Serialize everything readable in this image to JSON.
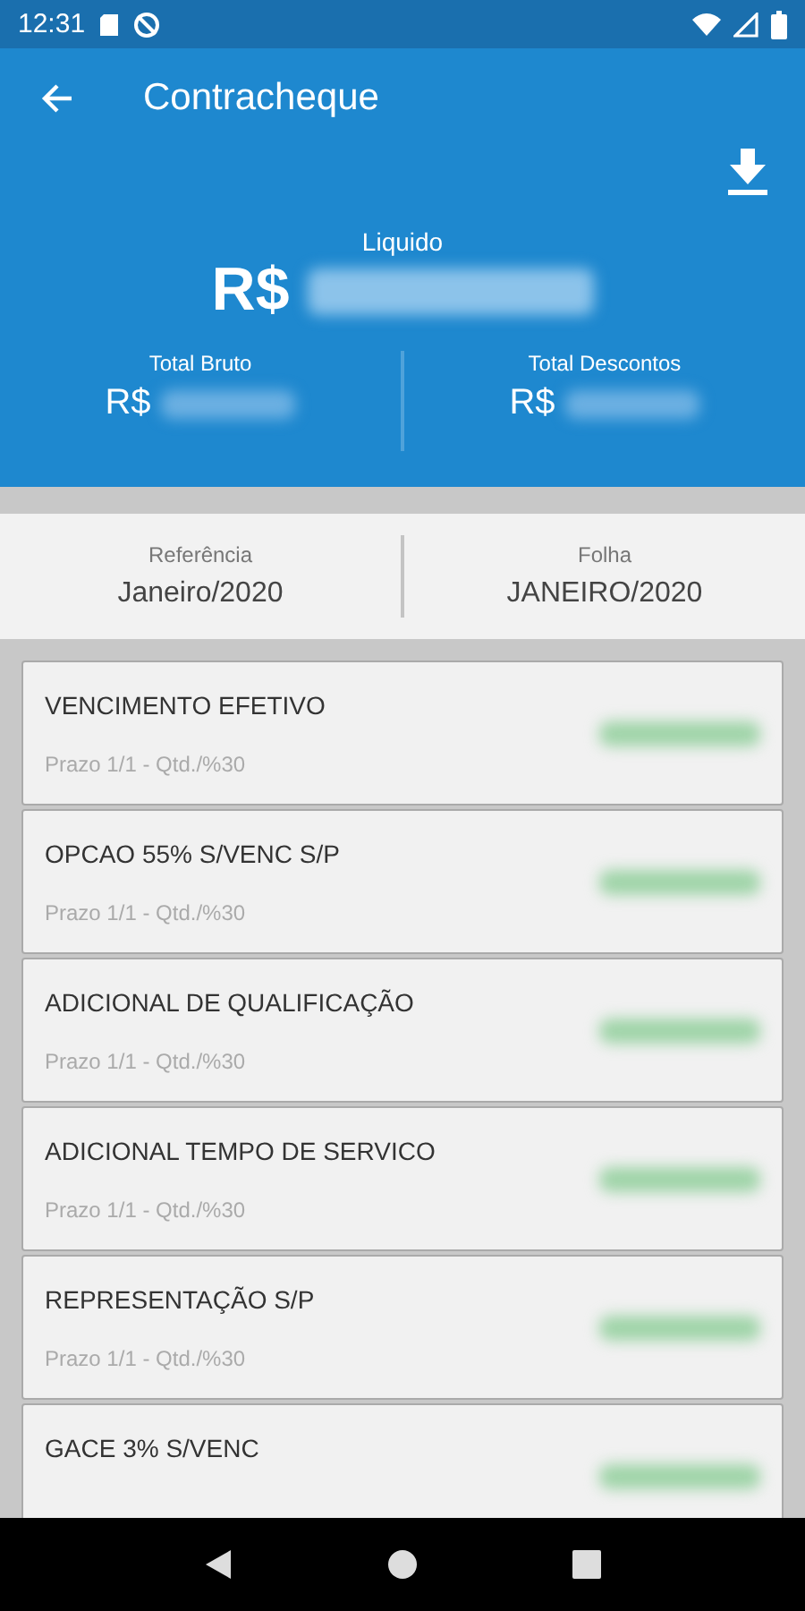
{
  "status_bar": {
    "time": "12:31"
  },
  "app_bar": {
    "title": "Contracheque"
  },
  "summary": {
    "net_label": "Liquido",
    "net_currency": "R$",
    "gross_label": "Total Bruto",
    "gross_currency": "R$",
    "deductions_label": "Total Descontos",
    "deductions_currency": "R$"
  },
  "period": {
    "reference_label": "Referência",
    "reference_value": "Janeiro/2020",
    "sheet_label": "Folha",
    "sheet_value": "JANEIRO/2020"
  },
  "items": [
    {
      "title": "VENCIMENTO EFETIVO",
      "detail": "Prazo 1/1 - Qtd./%30"
    },
    {
      "title": "OPCAO 55% S/VENC S/P",
      "detail": "Prazo 1/1 - Qtd./%30"
    },
    {
      "title": "ADICIONAL DE QUALIFICAÇÃO",
      "detail": "Prazo 1/1 - Qtd./%30"
    },
    {
      "title": "ADICIONAL TEMPO DE SERVICO",
      "detail": "Prazo 1/1 - Qtd./%30"
    },
    {
      "title": "REPRESENTAÇÃO S/P",
      "detail": "Prazo 1/1 - Qtd./%30"
    },
    {
      "title": "GACE 3% S/VENC"
    }
  ]
}
